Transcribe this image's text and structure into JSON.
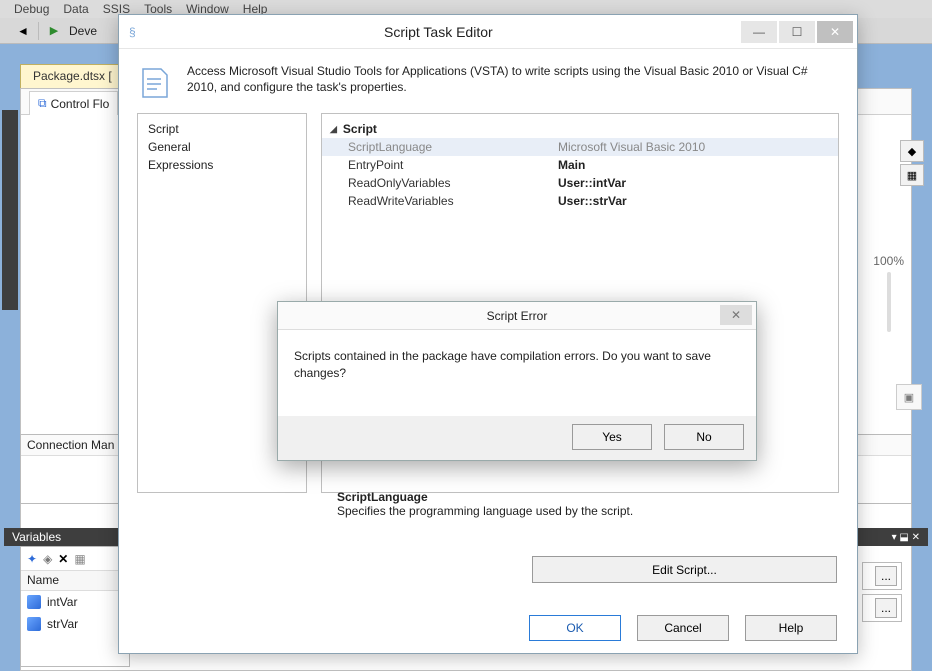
{
  "menu": {
    "items": [
      "Debug",
      "Data",
      "SSIS",
      "Tools",
      "Window",
      "Help"
    ]
  },
  "toolbar": {
    "config": "Deve"
  },
  "tabs": {
    "package": "Package.dtsx [",
    "controlFlow": "Control Flo"
  },
  "rightIcons": {
    "zoomLabel": "100%"
  },
  "conn": {
    "title": "Connection Man"
  },
  "variables": {
    "title": "Variables",
    "nameHeader": "Name",
    "rows": [
      "intVar",
      "strVar"
    ]
  },
  "editor": {
    "title": "Script Task Editor",
    "description": "Access Microsoft Visual Studio Tools for Applications (VSTA) to write scripts using the Visual Basic 2010 or Visual C# 2010, and configure the task's properties.",
    "nav": [
      "Script",
      "General",
      "Expressions"
    ],
    "section": "Script",
    "props": [
      {
        "key": "ScriptLanguage",
        "val": "Microsoft Visual Basic 2010",
        "sel": true
      },
      {
        "key": "EntryPoint",
        "val": "Main"
      },
      {
        "key": "ReadOnlyVariables",
        "val": "User::intVar"
      },
      {
        "key": "ReadWriteVariables",
        "val": "User::strVar"
      }
    ],
    "footerTitle": "ScriptLanguage",
    "footerDesc": "Specifies the programming language used by the script.",
    "editScript": "Edit Script...",
    "ok": "OK",
    "cancel": "Cancel",
    "help": "Help"
  },
  "error": {
    "title": "Script Error",
    "message": "Scripts contained in the package have compilation errors. Do you want to save changes?",
    "yes": "Yes",
    "no": "No"
  },
  "ellipsis": "..."
}
